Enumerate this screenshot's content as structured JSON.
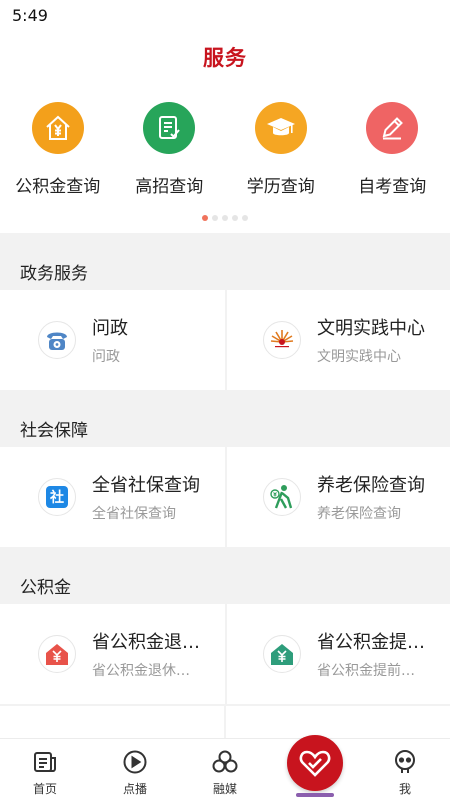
{
  "status": {
    "time": "5:49"
  },
  "header": {
    "title": "服务"
  },
  "quick": [
    {
      "label": "公积金查询",
      "icon": "house-yuan-icon",
      "color": "#f3a01b"
    },
    {
      "label": "高招查询",
      "icon": "checklist-icon",
      "color": "#27a55a"
    },
    {
      "label": "学历查询",
      "icon": "graduation-cap-icon",
      "color": "#f5a623"
    },
    {
      "label": "自考查询",
      "icon": "pencil-icon",
      "color": "#ef6464"
    }
  ],
  "pager": {
    "active_dot_color": "#f0735c"
  },
  "sections": [
    {
      "title": "政务服务",
      "items": [
        {
          "title": "问政",
          "subtitle": "问政",
          "icon": "telephone-icon"
        },
        {
          "title": "文明实践中心",
          "subtitle": "文明实践中心",
          "icon": "civilization-logo-icon"
        }
      ]
    },
    {
      "title": "社会保障",
      "items": [
        {
          "title": "全省社保查询",
          "subtitle": "全省社保查询",
          "icon": "social-security-icon",
          "icon_text": "社"
        },
        {
          "title": "养老保险查询",
          "subtitle": "养老保险查询",
          "icon": "elderly-pension-icon"
        }
      ]
    },
    {
      "title": "公积金",
      "items": [
        {
          "title": "省公积金退…",
          "subtitle": "省公积金退休…",
          "icon": "red-house-yuan-icon"
        },
        {
          "title": "省公积金提…",
          "subtitle": "省公积金提前…",
          "icon": "green-house-yuan-icon"
        }
      ]
    }
  ],
  "tabs": [
    {
      "label": "首页",
      "icon": "news-icon"
    },
    {
      "label": "点播",
      "icon": "play-circle-icon"
    },
    {
      "label": "融媒",
      "icon": "three-circles-icon"
    },
    {
      "label": "",
      "icon": "heart-handshake-icon"
    },
    {
      "label": "我",
      "icon": "profile-bot-icon"
    }
  ],
  "colors": {
    "brand_red": "#c8141e",
    "background_gray": "#f2f2f2"
  }
}
